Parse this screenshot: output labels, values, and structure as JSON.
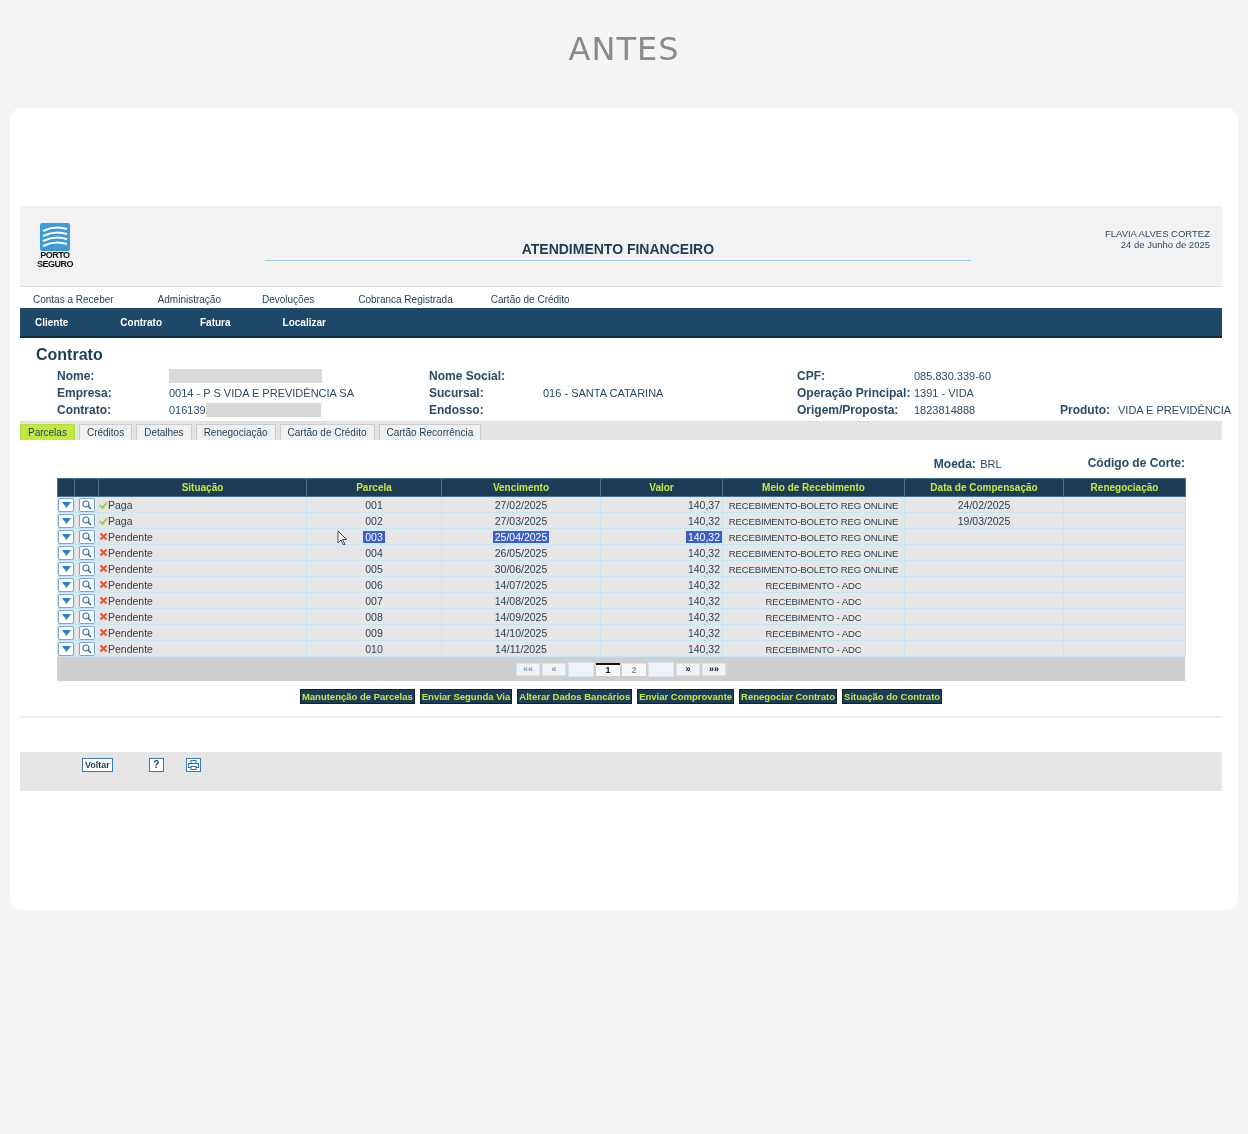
{
  "frame_title": "ANTES",
  "header": {
    "logo_lines": [
      "PORTO",
      "SEGURO"
    ],
    "title": "ATENDIMENTO FINANCEIRO",
    "user": "FLAVIA ALVES CORTEZ",
    "date": "24 de Junho de 2025"
  },
  "top_menu": [
    "Contas a Receber",
    "Administração",
    "Devoluções",
    "Cobranca Registrada",
    "Cartão de Crédito"
  ],
  "main_menu": [
    "Cliente",
    "Contrato",
    "Fatura",
    "Localizar"
  ],
  "section_title": "Contrato",
  "info_rows": [
    [
      {
        "label": "Nome:",
        "redacted": true
      },
      {
        "label": "Nome Social:"
      },
      {
        "label": "CPF:",
        "value": "085.830.339-60"
      }
    ],
    [
      {
        "label": "Empresa:",
        "value": "0014 - P S VIDA E PREVIDÊNCIA SA"
      },
      {
        "label": "Sucursal:",
        "value": "016 - SANTA CATARINA"
      },
      {
        "label": "Operação Principal:",
        "value": "1391 - VIDA"
      }
    ],
    [
      {
        "label": "Contrato:",
        "value": "016139",
        "redacted": true
      },
      {
        "label": "Endosso:"
      },
      {
        "label": "Origem/Proposta:",
        "value": "1823814888"
      },
      {
        "label": "Produto:",
        "value": "VIDA E PREVIDÊNCIA"
      }
    ]
  ],
  "tabs": [
    {
      "label": "Parcelas",
      "selected": true
    },
    {
      "label": "Créditos",
      "selected": false
    },
    {
      "label": "Detalhes",
      "selected": false
    },
    {
      "label": "Renegociação",
      "selected": false
    },
    {
      "label": "Cartão de Crédito",
      "selected": false
    },
    {
      "label": "Cartão Recorrência",
      "selected": false
    }
  ],
  "currency": {
    "label": "Moeda:",
    "value": "BRL"
  },
  "cut_code": {
    "label": "Código de Corte:"
  },
  "table": {
    "columns": [
      "Situação",
      "Parcela",
      "Vencimento",
      "Valor",
      "Meio de Recebimento",
      "Data de Compensação",
      "Renegociação"
    ],
    "rows": [
      {
        "status": "Paga",
        "kind": "paid",
        "parcela": "001",
        "vencimento": "27/02/2025",
        "valor": "140,37",
        "meio": "RECEBIMENTO-BOLETO REG ONLINE",
        "compensacao": "24/02/2025",
        "selected": false
      },
      {
        "status": "Paga",
        "kind": "paid",
        "parcela": "002",
        "vencimento": "27/03/2025",
        "valor": "140,32",
        "meio": "RECEBIMENTO-BOLETO REG ONLINE",
        "compensacao": "19/03/2025",
        "selected": false
      },
      {
        "status": "Pendente",
        "kind": "pending",
        "parcela": "003",
        "vencimento": "25/04/2025",
        "valor": "140,32",
        "meio": "RECEBIMENTO-BOLETO REG ONLINE",
        "selected": true
      },
      {
        "status": "Pendente",
        "kind": "pending",
        "parcela": "004",
        "vencimento": "26/05/2025",
        "valor": "140,32",
        "meio": "RECEBIMENTO-BOLETO REG ONLINE",
        "selected": false
      },
      {
        "status": "Pendente",
        "kind": "pending",
        "parcela": "005",
        "vencimento": "30/06/2025",
        "valor": "140,32",
        "meio": "RECEBIMENTO-BOLETO REG ONLINE",
        "selected": false
      },
      {
        "status": "Pendente",
        "kind": "pending",
        "parcela": "006",
        "vencimento": "14/07/2025",
        "valor": "140,32",
        "meio": "RECEBIMENTO - ADC",
        "selected": false
      },
      {
        "status": "Pendente",
        "kind": "pending",
        "parcela": "007",
        "vencimento": "14/08/2025",
        "valor": "140,32",
        "meio": "RECEBIMENTO - ADC",
        "selected": false
      },
      {
        "status": "Pendente",
        "kind": "pending",
        "parcela": "008",
        "vencimento": "14/09/2025",
        "valor": "140,32",
        "meio": "RECEBIMENTO - ADC",
        "selected": false
      },
      {
        "status": "Pendente",
        "kind": "pending",
        "parcela": "009",
        "vencimento": "14/10/2025",
        "valor": "140,32",
        "meio": "RECEBIMENTO - ADC",
        "selected": false
      },
      {
        "status": "Pendente",
        "kind": "pending",
        "parcela": "010",
        "vencimento": "14/11/2025",
        "valor": "140,32",
        "meio": "RECEBIMENTO - ADC",
        "selected": false
      }
    ]
  },
  "pager": {
    "first": "««",
    "prev": "«",
    "pages": [
      {
        "label": "1",
        "selected": true
      },
      {
        "label": "2",
        "selected": false
      }
    ],
    "next": "»",
    "last": "»»"
  },
  "actions": [
    "Manutenção de Parcelas",
    "Enviar Segunda Via",
    "Alterar Dados Bancários",
    "Enviar Comprovante",
    "Renegociar Contrato",
    "Situação do Contrato"
  ],
  "footer": {
    "back": "Voltar",
    "help": "?"
  }
}
